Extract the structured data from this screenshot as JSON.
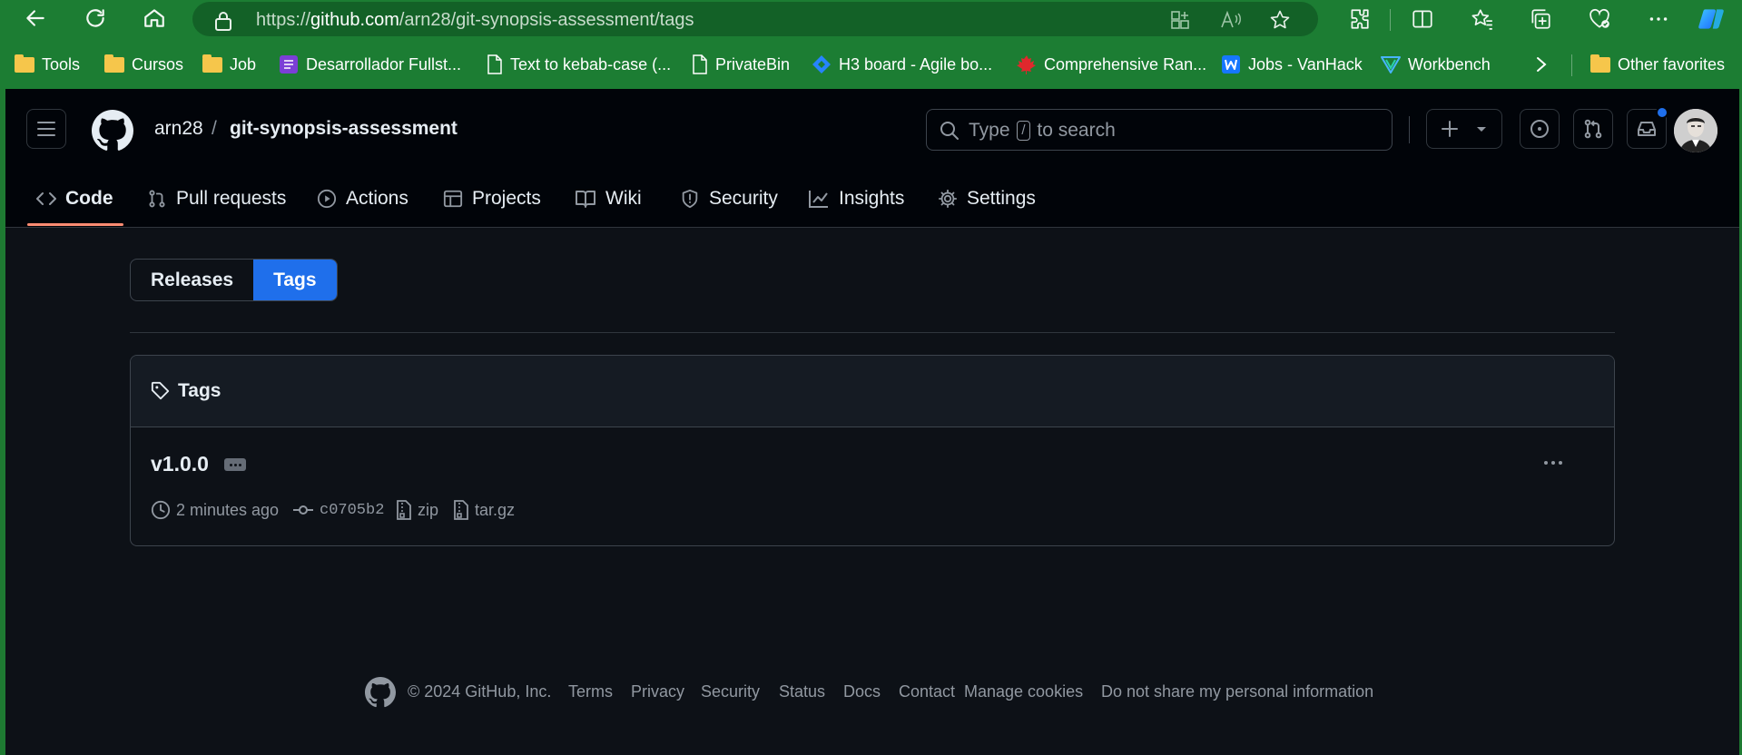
{
  "browser": {
    "url_prefix": "https://",
    "url_host": "github.com",
    "url_path": "/arn28/git-synopsis-assessment/tags",
    "bookmarks": [
      {
        "label": "Tools",
        "icon": "folder-icon"
      },
      {
        "label": "Cursos",
        "icon": "folder-icon"
      },
      {
        "label": "Job",
        "icon": "folder-icon"
      },
      {
        "label": "Desarrollador Fullst...",
        "icon": "form-icon"
      },
      {
        "label": "Text to kebab-case (...",
        "icon": "page-icon"
      },
      {
        "label": "PrivateBin",
        "icon": "page-icon"
      },
      {
        "label": "H3 board - Agile bo...",
        "icon": "jira-icon"
      },
      {
        "label": "Comprehensive Ran...",
        "icon": "maple-leaf-icon"
      },
      {
        "label": "Jobs - VanHack",
        "icon": "vanhack-icon"
      },
      {
        "label": "Workbench",
        "icon": "workbench-icon"
      },
      {
        "label": "Other favorites",
        "icon": "folder-icon"
      }
    ]
  },
  "header": {
    "owner": "arn28",
    "separator": "/",
    "repo": "git-synopsis-assessment",
    "search_prefix": "Type",
    "search_key": "/",
    "search_suffix": "to search"
  },
  "repo_tabs": [
    {
      "label": "Code",
      "icon": "code-icon",
      "active": true
    },
    {
      "label": "Pull requests",
      "icon": "pull-request-icon"
    },
    {
      "label": "Actions",
      "icon": "play-icon"
    },
    {
      "label": "Projects",
      "icon": "table-icon"
    },
    {
      "label": "Wiki",
      "icon": "book-icon"
    },
    {
      "label": "Security",
      "icon": "shield-icon"
    },
    {
      "label": "Insights",
      "icon": "graph-icon"
    },
    {
      "label": "Settings",
      "icon": "gear-icon"
    }
  ],
  "segmented": {
    "releases": "Releases",
    "tags": "Tags",
    "selected": "Tags"
  },
  "tags_box": {
    "title": "Tags",
    "items": [
      {
        "name": "v1.0.0",
        "time": "2 minutes ago",
        "commit": "c0705b2",
        "zip": "zip",
        "targz": "tar.gz"
      }
    ]
  },
  "footer": {
    "copyright": "© 2024 GitHub, Inc.",
    "links": [
      "Terms",
      "Privacy",
      "Security",
      "Status",
      "Docs",
      "Contact",
      "Manage cookies",
      "Do not share my personal information"
    ]
  },
  "colors": {
    "browser_frame": "#1c7d33",
    "page_bg": "#0d1117",
    "header_bg": "#010409",
    "accent_blue": "#1f6feb",
    "tab_underline": "#fd8c73"
  }
}
